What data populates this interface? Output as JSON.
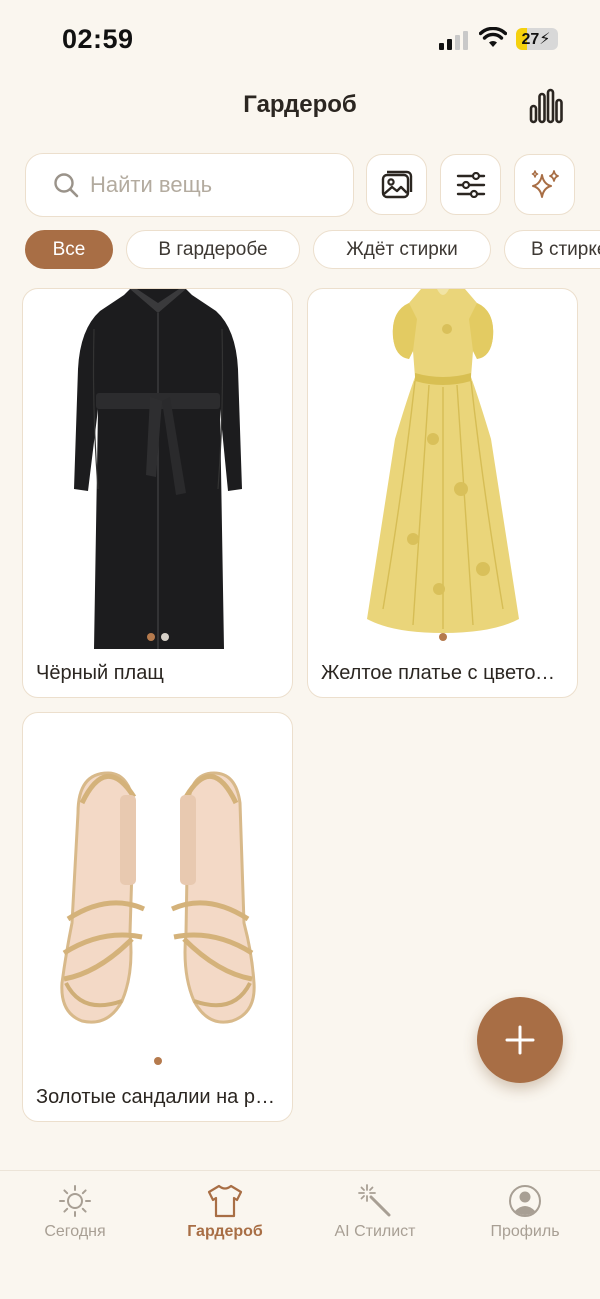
{
  "status_bar": {
    "time": "02:59",
    "battery_percent": "27",
    "battery_level": 0.27
  },
  "header": {
    "title": "Гардероб",
    "stats_icon": "bar-chart-icon"
  },
  "search": {
    "placeholder": "Найти вещь",
    "value": ""
  },
  "toolbar": {
    "photo_icon": "image-icon",
    "filter_icon": "sliders-icon",
    "ai_icon": "sparkles-icon"
  },
  "filters": [
    {
      "label": "Все",
      "active": true
    },
    {
      "label": "В гардеробе",
      "active": false
    },
    {
      "label": "Ждёт стирки",
      "active": false
    },
    {
      "label": "В стирке",
      "active": false
    }
  ],
  "items": [
    {
      "title": "Чёрный плащ",
      "image": "black-leather-trench-coat",
      "photos": 2,
      "current_photo": 1
    },
    {
      "title": "Желтое платье с цветочным принтом",
      "image": "yellow-floral-dress",
      "photos": 1,
      "current_photo": 1
    },
    {
      "title": "Золотые сандалии на ремешках",
      "image": "gold-strappy-sandals",
      "photos": 1,
      "current_photo": 1
    }
  ],
  "fab": {
    "icon": "plus-icon"
  },
  "tabs": [
    {
      "label": "Сегодня",
      "icon": "sun-icon",
      "active": false
    },
    {
      "label": "Гардероб",
      "icon": "tshirt-icon",
      "active": true
    },
    {
      "label": "AI Стилист",
      "icon": "magic-wand-icon",
      "active": false
    },
    {
      "label": "Профиль",
      "icon": "user-circle-icon",
      "active": false
    }
  ],
  "colors": {
    "accent": "#a86e45",
    "background": "#faf6ef",
    "border": "#ecdfcd",
    "muted": "#a89f94"
  }
}
